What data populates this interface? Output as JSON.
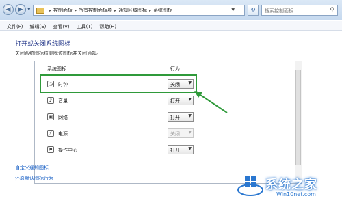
{
  "address": {
    "crumbs": [
      "控制面板",
      "所有控制面板项",
      "通知区域图标",
      "系统图标"
    ],
    "search_placeholder": "搜索控制面板"
  },
  "menu": [
    "文件(F)",
    "编辑(E)",
    "查看(V)",
    "工具(T)",
    "帮助(H)"
  ],
  "main": {
    "title": "打开或关闭系统图标",
    "subtitle": "关闭系统图标将删除该图标并关闭通知。",
    "col_icon": "系统图标",
    "col_behavior": "行为",
    "rows": [
      {
        "label": "时钟",
        "value": "关闭",
        "enabled": true,
        "icon": "clock-icon"
      },
      {
        "label": "音量",
        "value": "打开",
        "enabled": true,
        "icon": "volume-icon"
      },
      {
        "label": "网络",
        "value": "打开",
        "enabled": true,
        "icon": "network-icon"
      },
      {
        "label": "电源",
        "value": "关闭",
        "enabled": false,
        "icon": "power-icon"
      },
      {
        "label": "操作中心",
        "value": "打开",
        "enabled": true,
        "icon": "flag-icon"
      }
    ],
    "links": [
      "自定义通知图标",
      "还原默认图标行为"
    ]
  },
  "watermark": {
    "text": "系统之家",
    "sub": "Win10net.com"
  },
  "colors": {
    "highlight": "#2f9a3a",
    "link": "#0a56c2",
    "title": "#1e3287"
  }
}
